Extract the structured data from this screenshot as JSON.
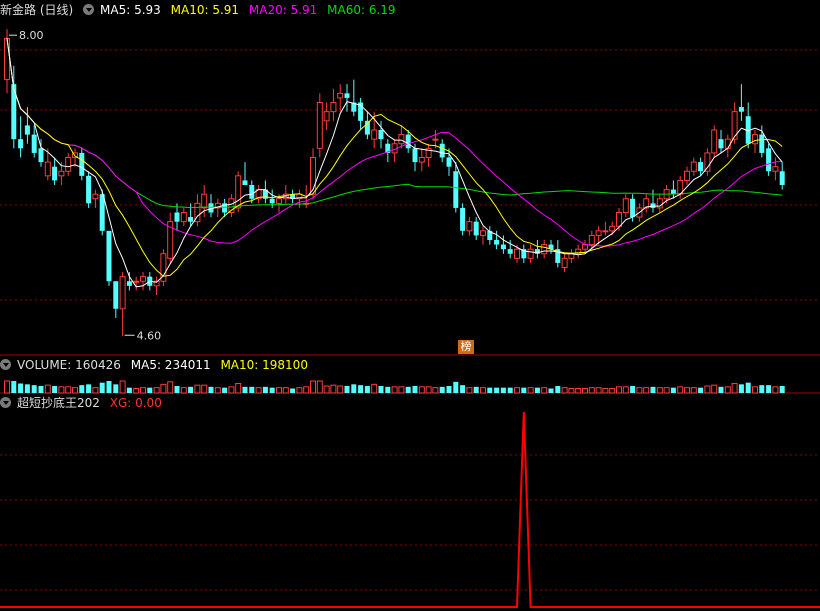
{
  "main": {
    "title": "新金路 (日线)",
    "ma5": "MA5: 5.93",
    "ma10": "MA10: 5.91",
    "ma20": "MA20: 5.91",
    "ma60": "MA60: 6.19",
    "high_label": "8.00",
    "low_label": "4.60",
    "badge": "榜"
  },
  "volume": {
    "title": "VOLUME: 160426",
    "ma5": "MA5: 234011",
    "ma10": "MA10: 198100"
  },
  "indicator": {
    "title": "超短抄底王202",
    "xg": "XG: 0.00"
  },
  "colors": {
    "up": "#ff3b3b",
    "down": "#54ffff",
    "ma5": "#ffffff",
    "ma10": "#ffff00",
    "ma20": "#ff00ff",
    "ma60": "#00dd00",
    "grid": "#8b0000",
    "xg": "#ff0000"
  },
  "chart_data": {
    "type": "candlestick",
    "ylim": [
      4.5,
      8.1
    ],
    "y_labels": {
      "high": 8.0,
      "low": 4.6
    },
    "ohlc": [
      [
        7.45,
        8.0,
        7.3,
        7.9
      ],
      [
        7.4,
        7.6,
        6.7,
        6.8
      ],
      [
        6.8,
        7.05,
        6.6,
        6.7
      ],
      [
        6.95,
        7.15,
        6.75,
        6.85
      ],
      [
        6.85,
        6.95,
        6.6,
        6.65
      ],
      [
        6.7,
        6.8,
        6.5,
        6.55
      ],
      [
        6.4,
        6.7,
        6.35,
        6.55
      ],
      [
        6.5,
        6.6,
        6.3,
        6.35
      ],
      [
        6.4,
        6.55,
        6.3,
        6.45
      ],
      [
        6.45,
        6.65,
        6.4,
        6.6
      ],
      [
        6.6,
        6.7,
        6.5,
        6.65
      ],
      [
        6.65,
        6.7,
        6.35,
        6.4
      ],
      [
        6.4,
        6.45,
        6.05,
        6.1
      ],
      [
        6.15,
        6.25,
        6.05,
        6.2
      ],
      [
        6.2,
        6.25,
        5.75,
        5.8
      ],
      [
        5.8,
        5.8,
        5.2,
        5.25
      ],
      [
        5.25,
        5.25,
        4.85,
        4.95
      ],
      [
        4.95,
        5.35,
        4.65,
        5.3
      ],
      [
        5.25,
        5.35,
        5.15,
        5.2
      ],
      [
        5.25,
        5.3,
        5.15,
        5.25
      ],
      [
        5.25,
        5.35,
        5.15,
        5.3
      ],
      [
        5.3,
        5.35,
        5.15,
        5.2
      ],
      [
        5.2,
        5.3,
        5.1,
        5.25
      ],
      [
        5.25,
        5.6,
        5.2,
        5.55
      ],
      [
        5.5,
        6.0,
        5.45,
        5.9
      ],
      [
        6.0,
        6.1,
        5.8,
        5.9
      ],
      [
        5.9,
        6.05,
        5.85,
        6.0
      ],
      [
        5.95,
        6.1,
        5.85,
        5.9
      ],
      [
        5.9,
        6.2,
        5.85,
        6.1
      ],
      [
        6.05,
        6.3,
        5.95,
        6.2
      ],
      [
        6.1,
        6.2,
        5.95,
        6.0
      ],
      [
        6.05,
        6.15,
        5.95,
        6.1
      ],
      [
        6.1,
        6.15,
        5.95,
        6.0
      ],
      [
        6.0,
        6.2,
        5.95,
        6.15
      ],
      [
        6.05,
        6.45,
        6.0,
        6.4
      ],
      [
        6.35,
        6.55,
        6.3,
        6.3
      ],
      [
        6.3,
        6.35,
        6.1,
        6.15
      ],
      [
        6.15,
        6.3,
        6.1,
        6.25
      ],
      [
        6.25,
        6.35,
        6.1,
        6.15
      ],
      [
        6.15,
        6.25,
        6.05,
        6.1
      ],
      [
        6.1,
        6.2,
        6.0,
        6.15
      ],
      [
        6.15,
        6.3,
        6.1,
        6.2
      ],
      [
        6.2,
        6.25,
        6.1,
        6.15
      ],
      [
        6.15,
        6.25,
        6.05,
        6.2
      ],
      [
        6.1,
        6.3,
        6.05,
        6.1
      ],
      [
        6.2,
        6.7,
        6.15,
        6.6
      ],
      [
        6.7,
        7.3,
        6.6,
        7.2
      ],
      [
        7.0,
        7.2,
        6.9,
        7.1
      ],
      [
        7.1,
        7.35,
        7.0,
        7.2
      ],
      [
        7.25,
        7.4,
        7.1,
        7.3
      ],
      [
        7.3,
        7.4,
        7.1,
        7.25
      ],
      [
        7.2,
        7.45,
        7.05,
        7.1
      ],
      [
        7.2,
        7.25,
        6.9,
        7.0
      ],
      [
        7.0,
        7.1,
        6.8,
        6.85
      ],
      [
        6.8,
        7.1,
        6.7,
        6.9
      ],
      [
        6.9,
        7.0,
        6.7,
        6.8
      ],
      [
        6.75,
        6.8,
        6.55,
        6.65
      ],
      [
        6.65,
        6.8,
        6.55,
        6.75
      ],
      [
        6.75,
        6.95,
        6.7,
        6.85
      ],
      [
        6.85,
        6.9,
        6.65,
        6.7
      ],
      [
        6.7,
        6.75,
        6.45,
        6.55
      ],
      [
        6.55,
        6.7,
        6.45,
        6.6
      ],
      [
        6.6,
        6.75,
        6.5,
        6.7
      ],
      [
        6.8,
        6.9,
        6.7,
        6.8
      ],
      [
        6.75,
        6.8,
        6.55,
        6.6
      ],
      [
        6.6,
        6.7,
        6.4,
        6.5
      ],
      [
        6.45,
        6.55,
        6.0,
        6.05
      ],
      [
        6.05,
        6.1,
        5.75,
        5.8
      ],
      [
        5.8,
        5.95,
        5.75,
        5.9
      ],
      [
        5.9,
        5.95,
        5.7,
        5.75
      ],
      [
        5.75,
        5.85,
        5.65,
        5.8
      ],
      [
        5.8,
        5.85,
        5.65,
        5.7
      ],
      [
        5.7,
        5.8,
        5.6,
        5.65
      ],
      [
        5.65,
        5.75,
        5.55,
        5.6
      ],
      [
        5.6,
        5.7,
        5.5,
        5.55
      ],
      [
        5.5,
        5.65,
        5.45,
        5.6
      ],
      [
        5.6,
        5.65,
        5.45,
        5.5
      ],
      [
        5.5,
        5.65,
        5.45,
        5.6
      ],
      [
        5.6,
        5.7,
        5.5,
        5.55
      ],
      [
        5.55,
        5.7,
        5.5,
        5.65
      ],
      [
        5.65,
        5.7,
        5.55,
        5.6
      ],
      [
        5.6,
        5.7,
        5.4,
        5.45
      ],
      [
        5.4,
        5.55,
        5.35,
        5.5
      ],
      [
        5.5,
        5.6,
        5.45,
        5.55
      ],
      [
        5.55,
        5.65,
        5.5,
        5.6
      ],
      [
        5.6,
        5.7,
        5.55,
        5.65
      ],
      [
        5.65,
        5.8,
        5.6,
        5.75
      ],
      [
        5.75,
        5.85,
        5.65,
        5.8
      ],
      [
        5.8,
        5.9,
        5.75,
        5.8
      ],
      [
        5.8,
        5.9,
        5.75,
        5.85
      ],
      [
        5.85,
        6.05,
        5.8,
        6.0
      ],
      [
        6.0,
        6.2,
        5.95,
        6.15
      ],
      [
        6.15,
        6.2,
        5.9,
        5.95
      ],
      [
        5.95,
        6.1,
        5.9,
        6.05
      ],
      [
        6.05,
        6.2,
        6.0,
        6.15
      ],
      [
        6.1,
        6.25,
        6.0,
        6.05
      ],
      [
        6.05,
        6.2,
        6.0,
        6.15
      ],
      [
        6.15,
        6.3,
        6.1,
        6.25
      ],
      [
        6.25,
        6.35,
        6.15,
        6.2
      ],
      [
        6.2,
        6.4,
        6.15,
        6.35
      ],
      [
        6.35,
        6.5,
        6.3,
        6.45
      ],
      [
        6.45,
        6.6,
        6.4,
        6.55
      ],
      [
        6.55,
        6.6,
        6.4,
        6.45
      ],
      [
        6.45,
        6.7,
        6.4,
        6.65
      ],
      [
        6.65,
        6.95,
        6.6,
        6.9
      ],
      [
        6.8,
        6.9,
        6.65,
        6.7
      ],
      [
        6.7,
        6.85,
        6.6,
        6.8
      ],
      [
        6.8,
        7.2,
        6.75,
        7.1
      ],
      [
        7.15,
        7.4,
        7.0,
        7.1
      ],
      [
        7.05,
        7.2,
        6.7,
        6.75
      ],
      [
        6.75,
        6.9,
        6.65,
        6.85
      ],
      [
        6.85,
        6.95,
        6.6,
        6.65
      ],
      [
        6.7,
        6.75,
        6.4,
        6.45
      ],
      [
        6.45,
        6.6,
        6.35,
        6.5
      ],
      [
        6.45,
        6.55,
        6.25,
        6.3
      ]
    ],
    "volume_ylim": [
      0,
      1000000
    ],
    "volume_peak_index": 45,
    "xg": {
      "values_at_peak": 1,
      "peak_index": 76,
      "baseline": 0
    }
  }
}
